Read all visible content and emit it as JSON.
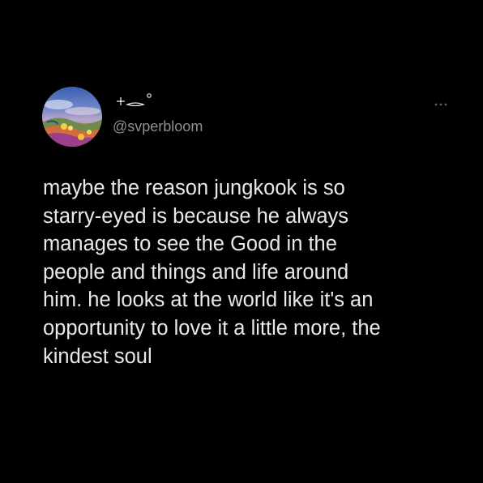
{
  "tweet": {
    "avatar_icon": "avatar-image",
    "display_name": "⊹˚‿˚",
    "handle": "@svperbloom",
    "more_icon": "more-horizontal-icon",
    "text_lines": [
      "maybe the reason jungkook is so",
      "starry-eyed is because he always",
      "manages to see the Good in the",
      "people and things and life around",
      "him. he looks at the world like it's an",
      "opportunity to love it a little more, the",
      "kindest soul"
    ]
  },
  "colors": {
    "background": "#000000",
    "text_primary": "#e7e9ea",
    "text_secondary": "#8b9097"
  }
}
